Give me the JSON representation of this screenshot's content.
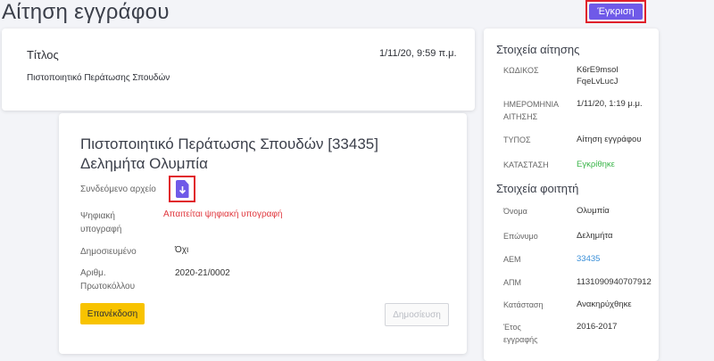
{
  "page": {
    "title": "Αίτηση εγγράφου",
    "approve_label": "Έγκριση"
  },
  "title_card": {
    "label": "Τίτλος",
    "date": "1/11/20, 9:59 π.μ.",
    "value": "Πιστοποιητικό Περάτωσης Σπουδών"
  },
  "main_card": {
    "heading": "Πιστοποιητικό Περάτωσης Σπουδών [33435] Δελημήτα Ολυμπία",
    "attached_file_label": "Συνδεόμενο αρχείο",
    "digital_signature_label": "Ψηφιακή υπογραφή",
    "digital_signature_value": "Απαιτείται ψηφιακή υπογραφή",
    "published_label": "Δημοσιευμένο",
    "published_value": "Όχι",
    "protocol_label": "Αριθμ. Πρωτοκόλλου",
    "protocol_value": "2020-21/0002",
    "reissue_label": "Επανέκδοση",
    "publish_label": "Δημοσίευση"
  },
  "request_details": {
    "heading": "Στοιχεία αίτησης",
    "code_label": "ΚΩΔΙΚΟΣ",
    "code_value": "K6rE9msol FqeLvLucJ",
    "date_label": "ΗΜΕΡΟΜΗΝΙΑ ΑΙΤΗΣΗΣ",
    "date_value": "1/11/20, 1:19 μ.μ.",
    "type_label": "ΤΥΠΟΣ",
    "type_value": "Αίτηση εγγράφου",
    "status_label": "ΚΑΤΑΣΤΑΣΗ",
    "status_value": "Εγκρίθηκε"
  },
  "student_details": {
    "heading": "Στοιχεία φοιτητή",
    "first_name_label": "Όνομα",
    "first_name_value": "Ολυμπία",
    "last_name_label": "Επώνυμο",
    "last_name_value": "Δελημήτα",
    "aem_label": "ΑΕΜ",
    "aem_value": "33435",
    "apm_label": "ΑΠΜ",
    "apm_value": "1131090940707912",
    "state_label": "Κατάσταση",
    "state_value": "Ανακηρύχθηκε",
    "year_label": "Έτος εγγραφής",
    "year_value": "2016-2017"
  },
  "colors": {
    "accent": "#6f5ae8",
    "warning": "#f8c300",
    "danger": "#e0383e",
    "success": "#3bb54a",
    "link": "#3a8fd8"
  },
  "icons": {
    "attached_file": "file-download-icon"
  }
}
